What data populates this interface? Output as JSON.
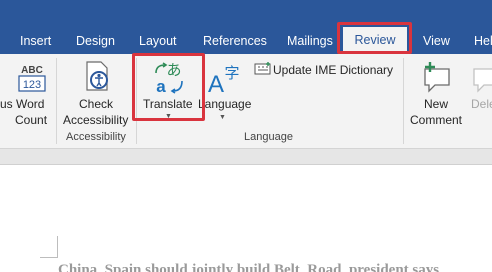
{
  "tabs": [
    {
      "label": "Insert"
    },
    {
      "label": "Design"
    },
    {
      "label": "Layout"
    },
    {
      "label": "References"
    },
    {
      "label": "Mailings"
    },
    {
      "label": "Review"
    },
    {
      "label": "View"
    },
    {
      "label": "Hel"
    }
  ],
  "ribbon": {
    "partial_label": "us",
    "word_count": {
      "line1": "Word",
      "line2": "Count",
      "icon_text": "ABC 123"
    },
    "check_accessibility": {
      "line1": "Check",
      "line2": "Accessibility"
    },
    "accessibility_group": "Accessibility",
    "translate": {
      "label": "Translate"
    },
    "language": {
      "label": "Language"
    },
    "update_ime": {
      "label": "Update IME Dictionary"
    },
    "language_group": "Language",
    "new_comment": {
      "line1": "New",
      "line2": "Comment"
    },
    "delete": {
      "label": "Dele"
    }
  },
  "document": {
    "text": "China, Spain should jointly build Belt, Road, president says"
  },
  "colors": {
    "title_bar": "#2b579a",
    "ribbon_bg": "#f3f3f3",
    "highlight": "#d9343e",
    "translate_icon_blue": "#1e73be",
    "translate_icon_green": "#2e8b57"
  }
}
